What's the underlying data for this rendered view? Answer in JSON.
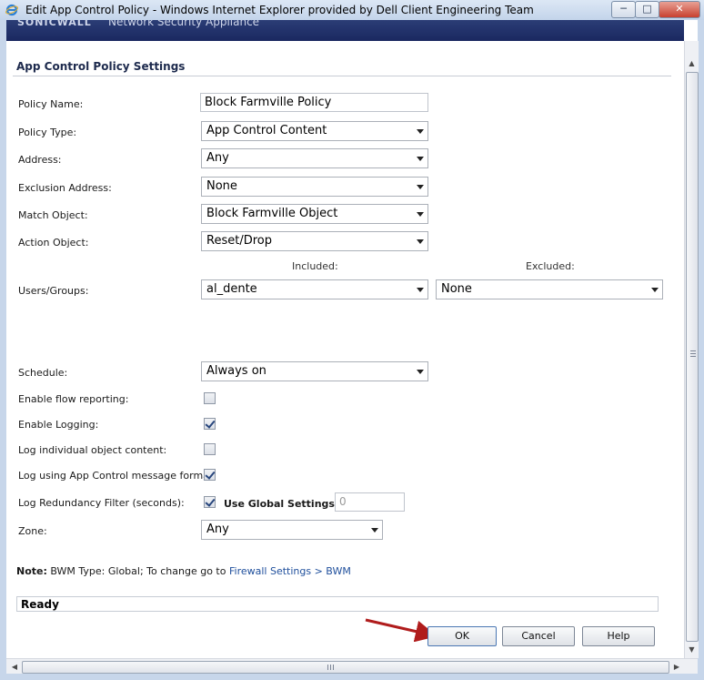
{
  "window": {
    "title": "Edit App Control Policy - Windows Internet Explorer provided by Dell Client Engineering Team",
    "minimize": "─",
    "maximize": "□",
    "close": "✕"
  },
  "header": {
    "logo": "SONICWALL",
    "subtitle": "Network Security Appliance"
  },
  "section": {
    "title": "App Control Policy Settings"
  },
  "form": {
    "policy_name": {
      "label": "Policy Name:",
      "value": "Block Farmville Policy"
    },
    "policy_type": {
      "label": "Policy Type:",
      "value": "App Control Content"
    },
    "address": {
      "label": "Address:",
      "value": "Any"
    },
    "exclusion_address": {
      "label": "Exclusion Address:",
      "value": "None"
    },
    "match_object": {
      "label": "Match Object:",
      "value": "Block Farmville Object"
    },
    "action_object": {
      "label": "Action Object:",
      "value": "Reset/Drop"
    },
    "users_groups": {
      "label": "Users/Groups:",
      "included_header": "Included:",
      "excluded_header": "Excluded:",
      "included_value": "al_dente",
      "excluded_value": "None"
    },
    "schedule": {
      "label": "Schedule:",
      "value": "Always on"
    },
    "enable_flow_reporting": {
      "label": "Enable flow reporting:",
      "checked": false
    },
    "enable_logging": {
      "label": "Enable Logging:",
      "checked": true
    },
    "log_individual_object_content": {
      "label": "Log individual object content:",
      "checked": false
    },
    "log_app_control_format": {
      "label": "Log using App Control message format:",
      "checked": true
    },
    "log_redundancy_filter": {
      "label": "Log Redundancy Filter (seconds):",
      "use_global_checked": true,
      "use_global_label": "Use Global Settings",
      "seconds_value": "0"
    },
    "zone": {
      "label": "Zone:",
      "value": "Any"
    }
  },
  "note": {
    "prefix": "Note:",
    "text": " BWM Type: Global; To change go to ",
    "link": "Firewall Settings > BWM"
  },
  "status": {
    "text": "Ready"
  },
  "buttons": {
    "ok": "OK",
    "cancel": "Cancel",
    "help": "Help"
  },
  "colors": {
    "header_bg": "#1a2860",
    "annotation_arrow": "#b01c1c",
    "link": "#1f4f9c"
  }
}
